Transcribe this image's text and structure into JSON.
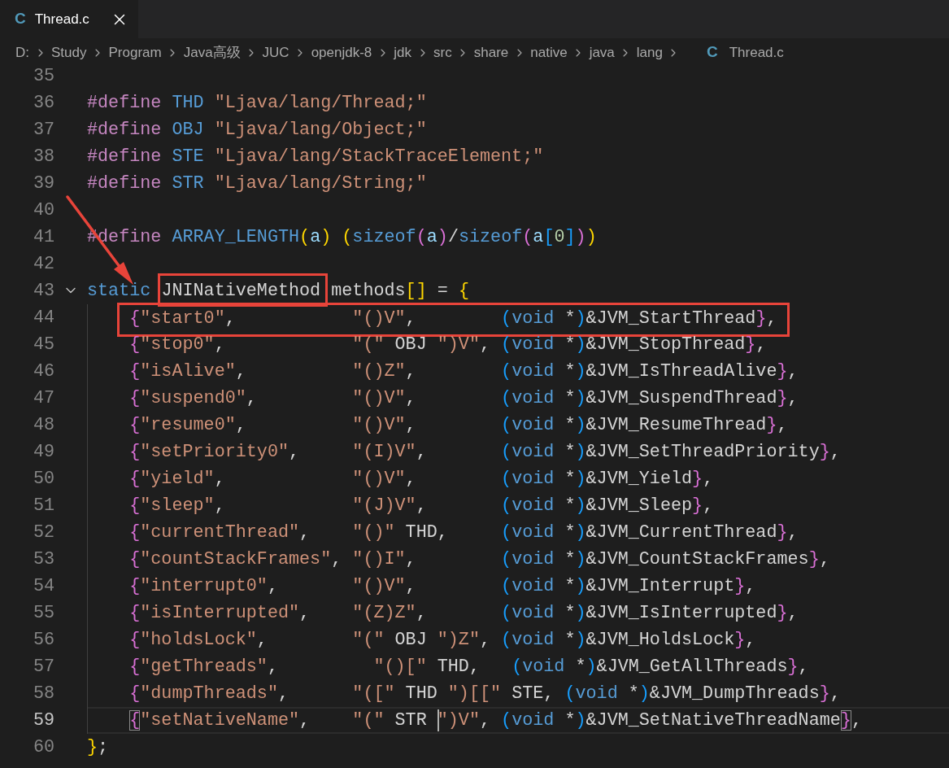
{
  "tabs": [
    {
      "icon": "C",
      "label": "Thread.c",
      "selected": true
    }
  ],
  "breadcrumb": [
    {
      "label": "D:"
    },
    {
      "label": "Study"
    },
    {
      "label": "Program"
    },
    {
      "label": "Java高级"
    },
    {
      "label": "JUC"
    },
    {
      "label": "openjdk-8"
    },
    {
      "label": "jdk"
    },
    {
      "label": "src"
    },
    {
      "label": "share"
    },
    {
      "label": "native"
    },
    {
      "label": "java"
    },
    {
      "label": "lang"
    },
    {
      "icon": "C",
      "label": "Thread.c"
    }
  ],
  "lines": [
    {
      "number": "35",
      "current": false
    },
    {
      "number": "36",
      "current": false,
      "highlighted": false,
      "tokens": [
        {
          "kind": "directive",
          "text": "#define "
        },
        {
          "kind": "macro",
          "text": "THD "
        },
        {
          "kind": "string",
          "text": "\"Ljava/lang/Thread;\""
        }
      ]
    },
    {
      "number": "37",
      "current": false,
      "highlighted": false,
      "tokens": [
        {
          "kind": "directive",
          "text": "#define "
        },
        {
          "kind": "macro",
          "text": "OBJ "
        },
        {
          "kind": "string",
          "text": "\"Ljava/lang/Object;\""
        }
      ]
    },
    {
      "number": "38",
      "current": false,
      "highlighted": false,
      "tokens": [
        {
          "kind": "directive",
          "text": "#define "
        },
        {
          "kind": "macro",
          "text": "STE "
        },
        {
          "kind": "string",
          "text": "\"Ljava/lang/StackTraceElement;\""
        }
      ]
    },
    {
      "number": "39",
      "current": false,
      "highlighted": false,
      "tokens": [
        {
          "kind": "directive",
          "text": "#define "
        },
        {
          "kind": "macro",
          "text": "STR "
        },
        {
          "kind": "string",
          "text": "\"Ljava/lang/String;\""
        }
      ]
    },
    {
      "number": "40",
      "current": false
    },
    {
      "number": "41",
      "current": false,
      "highlighted": false,
      "tokens": [
        {
          "kind": "directive",
          "text": "#define "
        },
        {
          "kind": "macro",
          "text": "ARRAY_LENGTH"
        },
        {
          "kind": "brace1",
          "text": "("
        },
        {
          "kind": "param",
          "text": "a"
        },
        {
          "kind": "brace1",
          "text": ") "
        },
        {
          "kind": "brace1",
          "text": "("
        },
        {
          "kind": "keyword",
          "text": "sizeof"
        },
        {
          "kind": "brace2",
          "text": "("
        },
        {
          "kind": "param",
          "text": "a"
        },
        {
          "kind": "brace2",
          "text": ")"
        },
        {
          "kind": "plain",
          "text": "/"
        },
        {
          "kind": "keyword",
          "text": "sizeof"
        },
        {
          "kind": "brace2",
          "text": "("
        },
        {
          "kind": "param",
          "text": "a"
        },
        {
          "kind": "brace3",
          "text": "["
        },
        {
          "kind": "number",
          "text": "0"
        },
        {
          "kind": "brace3",
          "text": "]"
        },
        {
          "kind": "brace2",
          "text": ")"
        },
        {
          "kind": "brace1",
          "text": ")"
        }
      ]
    },
    {
      "number": "42",
      "current": false
    },
    {
      "number": "43",
      "current": false,
      "highlighted": false,
      "expanded": true,
      "tokens": [
        {
          "kind": "keyword",
          "text": "static ",
          "highlighted": false
        },
        {
          "kind": "plain",
          "text": "JNINativeMethod",
          "highlighted": true
        },
        {
          "kind": "plain",
          "text": " methods",
          "highlighted": false
        },
        {
          "kind": "brace1",
          "text": "[]",
          "highlighted": false
        },
        {
          "kind": "plain",
          "text": " = ",
          "highlighted": false
        },
        {
          "kind": "brace1",
          "text": "{",
          "highlighted": false
        }
      ],
      "children": [
        {
          "number": "44",
          "current": false,
          "highlighted": true,
          "tokens": [
            {
              "kind": "brace2",
              "text": "{"
            },
            {
              "kind": "string",
              "text": "\"start0\""
            },
            {
              "kind": "plain",
              "text": ",           "
            },
            {
              "kind": "string",
              "text": "\"()V\""
            },
            {
              "kind": "plain",
              "text": ",        "
            },
            {
              "kind": "brace3",
              "text": "("
            },
            {
              "kind": "keyword",
              "text": "void"
            },
            {
              "kind": "plain",
              "text": " *"
            },
            {
              "kind": "brace3",
              "text": ")"
            },
            {
              "kind": "plain",
              "text": "&JVM_StartThread"
            },
            {
              "kind": "brace2",
              "text": "}"
            },
            {
              "kind": "plain",
              "text": ","
            }
          ]
        },
        {
          "number": "45",
          "current": false,
          "highlighted": false,
          "tokens": [
            {
              "kind": "brace2",
              "text": "{"
            },
            {
              "kind": "string",
              "text": "\"stop0\""
            },
            {
              "kind": "plain",
              "text": ",            "
            },
            {
              "kind": "string",
              "text": "\"(\""
            },
            {
              "kind": "plain",
              "text": " OBJ "
            },
            {
              "kind": "string",
              "text": "\")V\""
            },
            {
              "kind": "plain",
              "text": ", "
            },
            {
              "kind": "brace3",
              "text": "("
            },
            {
              "kind": "keyword",
              "text": "void"
            },
            {
              "kind": "plain",
              "text": " *"
            },
            {
              "kind": "brace3",
              "text": ")"
            },
            {
              "kind": "plain",
              "text": "&JVM_StopThread"
            },
            {
              "kind": "brace2",
              "text": "}"
            },
            {
              "kind": "plain",
              "text": ","
            }
          ]
        },
        {
          "number": "46",
          "current": false,
          "highlighted": false,
          "tokens": [
            {
              "kind": "brace2",
              "text": "{"
            },
            {
              "kind": "string",
              "text": "\"isAlive\""
            },
            {
              "kind": "plain",
              "text": ",          "
            },
            {
              "kind": "string",
              "text": "\"()Z\""
            },
            {
              "kind": "plain",
              "text": ",        "
            },
            {
              "kind": "brace3",
              "text": "("
            },
            {
              "kind": "keyword",
              "text": "void"
            },
            {
              "kind": "plain",
              "text": " *"
            },
            {
              "kind": "brace3",
              "text": ")"
            },
            {
              "kind": "plain",
              "text": "&JVM_IsThreadAlive"
            },
            {
              "kind": "brace2",
              "text": "}"
            },
            {
              "kind": "plain",
              "text": ","
            }
          ]
        },
        {
          "number": "47",
          "current": false,
          "highlighted": false,
          "tokens": [
            {
              "kind": "brace2",
              "text": "{"
            },
            {
              "kind": "string",
              "text": "\"suspend0\""
            },
            {
              "kind": "plain",
              "text": ",         "
            },
            {
              "kind": "string",
              "text": "\"()V\""
            },
            {
              "kind": "plain",
              "text": ",        "
            },
            {
              "kind": "brace3",
              "text": "("
            },
            {
              "kind": "keyword",
              "text": "void"
            },
            {
              "kind": "plain",
              "text": " *"
            },
            {
              "kind": "brace3",
              "text": ")"
            },
            {
              "kind": "plain",
              "text": "&JVM_SuspendThread"
            },
            {
              "kind": "brace2",
              "text": "}"
            },
            {
              "kind": "plain",
              "text": ","
            }
          ]
        },
        {
          "number": "48",
          "current": false,
          "highlighted": false,
          "tokens": [
            {
              "kind": "brace2",
              "text": "{"
            },
            {
              "kind": "string",
              "text": "\"resume0\""
            },
            {
              "kind": "plain",
              "text": ",          "
            },
            {
              "kind": "string",
              "text": "\"()V\""
            },
            {
              "kind": "plain",
              "text": ",        "
            },
            {
              "kind": "brace3",
              "text": "("
            },
            {
              "kind": "keyword",
              "text": "void"
            },
            {
              "kind": "plain",
              "text": " *"
            },
            {
              "kind": "brace3",
              "text": ")"
            },
            {
              "kind": "plain",
              "text": "&JVM_ResumeThread"
            },
            {
              "kind": "brace2",
              "text": "}"
            },
            {
              "kind": "plain",
              "text": ","
            }
          ]
        },
        {
          "number": "49",
          "current": false,
          "highlighted": false,
          "tokens": [
            {
              "kind": "brace2",
              "text": "{"
            },
            {
              "kind": "string",
              "text": "\"setPriority0\""
            },
            {
              "kind": "plain",
              "text": ",     "
            },
            {
              "kind": "string",
              "text": "\"(I)V\""
            },
            {
              "kind": "plain",
              "text": ",       "
            },
            {
              "kind": "brace3",
              "text": "("
            },
            {
              "kind": "keyword",
              "text": "void"
            },
            {
              "kind": "plain",
              "text": " *"
            },
            {
              "kind": "brace3",
              "text": ")"
            },
            {
              "kind": "plain",
              "text": "&JVM_SetThreadPriority"
            },
            {
              "kind": "brace2",
              "text": "}"
            },
            {
              "kind": "plain",
              "text": ","
            }
          ]
        },
        {
          "number": "50",
          "current": false,
          "highlighted": false,
          "tokens": [
            {
              "kind": "brace2",
              "text": "{"
            },
            {
              "kind": "string",
              "text": "\"yield\""
            },
            {
              "kind": "plain",
              "text": ",            "
            },
            {
              "kind": "string",
              "text": "\"()V\""
            },
            {
              "kind": "plain",
              "text": ",        "
            },
            {
              "kind": "brace3",
              "text": "("
            },
            {
              "kind": "keyword",
              "text": "void"
            },
            {
              "kind": "plain",
              "text": " *"
            },
            {
              "kind": "brace3",
              "text": ")"
            },
            {
              "kind": "plain",
              "text": "&JVM_Yield"
            },
            {
              "kind": "brace2",
              "text": "}"
            },
            {
              "kind": "plain",
              "text": ","
            }
          ]
        },
        {
          "number": "51",
          "current": false,
          "highlighted": false,
          "tokens": [
            {
              "kind": "brace2",
              "text": "{"
            },
            {
              "kind": "string",
              "text": "\"sleep\""
            },
            {
              "kind": "plain",
              "text": ",            "
            },
            {
              "kind": "string",
              "text": "\"(J)V\""
            },
            {
              "kind": "plain",
              "text": ",       "
            },
            {
              "kind": "brace3",
              "text": "("
            },
            {
              "kind": "keyword",
              "text": "void"
            },
            {
              "kind": "plain",
              "text": " *"
            },
            {
              "kind": "brace3",
              "text": ")"
            },
            {
              "kind": "plain",
              "text": "&JVM_Sleep"
            },
            {
              "kind": "brace2",
              "text": "}"
            },
            {
              "kind": "plain",
              "text": ","
            }
          ]
        },
        {
          "number": "52",
          "current": false,
          "highlighted": false,
          "tokens": [
            {
              "kind": "brace2",
              "text": "{"
            },
            {
              "kind": "string",
              "text": "\"currentThread\""
            },
            {
              "kind": "plain",
              "text": ",    "
            },
            {
              "kind": "string",
              "text": "\"()\""
            },
            {
              "kind": "plain",
              "text": " THD,     "
            },
            {
              "kind": "brace3",
              "text": "("
            },
            {
              "kind": "keyword",
              "text": "void"
            },
            {
              "kind": "plain",
              "text": " *"
            },
            {
              "kind": "brace3",
              "text": ")"
            },
            {
              "kind": "plain",
              "text": "&JVM_CurrentThread"
            },
            {
              "kind": "brace2",
              "text": "}"
            },
            {
              "kind": "plain",
              "text": ","
            }
          ]
        },
        {
          "number": "53",
          "current": false,
          "highlighted": false,
          "tokens": [
            {
              "kind": "brace2",
              "text": "{"
            },
            {
              "kind": "string",
              "text": "\"countStackFrames\""
            },
            {
              "kind": "plain",
              "text": ", "
            },
            {
              "kind": "string",
              "text": "\"()I\""
            },
            {
              "kind": "plain",
              "text": ",        "
            },
            {
              "kind": "brace3",
              "text": "("
            },
            {
              "kind": "keyword",
              "text": "void"
            },
            {
              "kind": "plain",
              "text": " *"
            },
            {
              "kind": "brace3",
              "text": ")"
            },
            {
              "kind": "plain",
              "text": "&JVM_CountStackFrames"
            },
            {
              "kind": "brace2",
              "text": "}"
            },
            {
              "kind": "plain",
              "text": ","
            }
          ]
        },
        {
          "number": "54",
          "current": false,
          "highlighted": false,
          "tokens": [
            {
              "kind": "brace2",
              "text": "{"
            },
            {
              "kind": "string",
              "text": "\"interrupt0\""
            },
            {
              "kind": "plain",
              "text": ",       "
            },
            {
              "kind": "string",
              "text": "\"()V\""
            },
            {
              "kind": "plain",
              "text": ",        "
            },
            {
              "kind": "brace3",
              "text": "("
            },
            {
              "kind": "keyword",
              "text": "void"
            },
            {
              "kind": "plain",
              "text": " *"
            },
            {
              "kind": "brace3",
              "text": ")"
            },
            {
              "kind": "plain",
              "text": "&JVM_Interrupt"
            },
            {
              "kind": "brace2",
              "text": "}"
            },
            {
              "kind": "plain",
              "text": ","
            }
          ]
        },
        {
          "number": "55",
          "current": false,
          "highlighted": false,
          "tokens": [
            {
              "kind": "brace2",
              "text": "{"
            },
            {
              "kind": "string",
              "text": "\"isInterrupted\""
            },
            {
              "kind": "plain",
              "text": ",    "
            },
            {
              "kind": "string",
              "text": "\"(Z)Z\""
            },
            {
              "kind": "plain",
              "text": ",       "
            },
            {
              "kind": "brace3",
              "text": "("
            },
            {
              "kind": "keyword",
              "text": "void"
            },
            {
              "kind": "plain",
              "text": " *"
            },
            {
              "kind": "brace3",
              "text": ")"
            },
            {
              "kind": "plain",
              "text": "&JVM_IsInterrupted"
            },
            {
              "kind": "brace2",
              "text": "}"
            },
            {
              "kind": "plain",
              "text": ","
            }
          ]
        },
        {
          "number": "56",
          "current": false,
          "highlighted": false,
          "tokens": [
            {
              "kind": "brace2",
              "text": "{"
            },
            {
              "kind": "string",
              "text": "\"holdsLock\""
            },
            {
              "kind": "plain",
              "text": ",        "
            },
            {
              "kind": "string",
              "text": "\"(\""
            },
            {
              "kind": "plain",
              "text": " OBJ "
            },
            {
              "kind": "string",
              "text": "\")Z\""
            },
            {
              "kind": "plain",
              "text": ", "
            },
            {
              "kind": "brace3",
              "text": "("
            },
            {
              "kind": "keyword",
              "text": "void"
            },
            {
              "kind": "plain",
              "text": " *"
            },
            {
              "kind": "brace3",
              "text": ")"
            },
            {
              "kind": "plain",
              "text": "&JVM_HoldsLock"
            },
            {
              "kind": "brace2",
              "text": "}"
            },
            {
              "kind": "plain",
              "text": ","
            }
          ]
        },
        {
          "number": "57",
          "current": false,
          "highlighted": false,
          "tokens": [
            {
              "kind": "brace2",
              "text": "{"
            },
            {
              "kind": "string",
              "text": "\"getThreads\""
            },
            {
              "kind": "plain",
              "text": ",         "
            },
            {
              "kind": "string",
              "text": "\"()[\""
            },
            {
              "kind": "plain",
              "text": " THD,   "
            },
            {
              "kind": "brace3",
              "text": "("
            },
            {
              "kind": "keyword",
              "text": "void"
            },
            {
              "kind": "plain",
              "text": " *"
            },
            {
              "kind": "brace3",
              "text": ")"
            },
            {
              "kind": "plain",
              "text": "&JVM_GetAllThreads"
            },
            {
              "kind": "brace2",
              "text": "}"
            },
            {
              "kind": "plain",
              "text": ","
            }
          ]
        },
        {
          "number": "58",
          "current": false,
          "highlighted": false,
          "tokens": [
            {
              "kind": "brace2",
              "text": "{"
            },
            {
              "kind": "string",
              "text": "\"dumpThreads\""
            },
            {
              "kind": "plain",
              "text": ",      "
            },
            {
              "kind": "string",
              "text": "\"([\""
            },
            {
              "kind": "plain",
              "text": " THD "
            },
            {
              "kind": "string",
              "text": "\")[[\""
            },
            {
              "kind": "plain",
              "text": " STE, "
            },
            {
              "kind": "brace3",
              "text": "("
            },
            {
              "kind": "keyword",
              "text": "void"
            },
            {
              "kind": "plain",
              "text": " *"
            },
            {
              "kind": "brace3",
              "text": ")"
            },
            {
              "kind": "plain",
              "text": "&JVM_DumpThreads"
            },
            {
              "kind": "brace2",
              "text": "}"
            },
            {
              "kind": "plain",
              "text": ","
            }
          ]
        },
        {
          "number": "59",
          "current": true,
          "highlighted": false,
          "tokens": [
            {
              "kind": "matched",
              "text": "{"
            },
            {
              "kind": "string",
              "text": "\"setNativeName\""
            },
            {
              "kind": "plain",
              "text": ",    "
            },
            {
              "kind": "string",
              "text": "\"(\""
            },
            {
              "kind": "plain",
              "text": " STR "
            },
            {
              "kind": "cursor"
            },
            {
              "kind": "string",
              "text": "\")V\""
            },
            {
              "kind": "plain",
              "text": ", "
            },
            {
              "kind": "brace3",
              "text": "("
            },
            {
              "kind": "keyword",
              "text": "void"
            },
            {
              "kind": "plain",
              "text": " *"
            },
            {
              "kind": "brace3",
              "text": ")"
            },
            {
              "kind": "plain",
              "text": "&JVM_SetNativeThreadName"
            },
            {
              "kind": "matched",
              "text": "}"
            },
            {
              "kind": "plain",
              "text": ","
            }
          ]
        }
      ]
    },
    {
      "number": "60",
      "current": false,
      "highlighted": false,
      "tokens": [
        {
          "kind": "brace1",
          "text": "}"
        },
        {
          "kind": "plain",
          "text": ";"
        }
      ]
    }
  ],
  "annotations": [
    {
      "kind": "arrow"
    }
  ]
}
